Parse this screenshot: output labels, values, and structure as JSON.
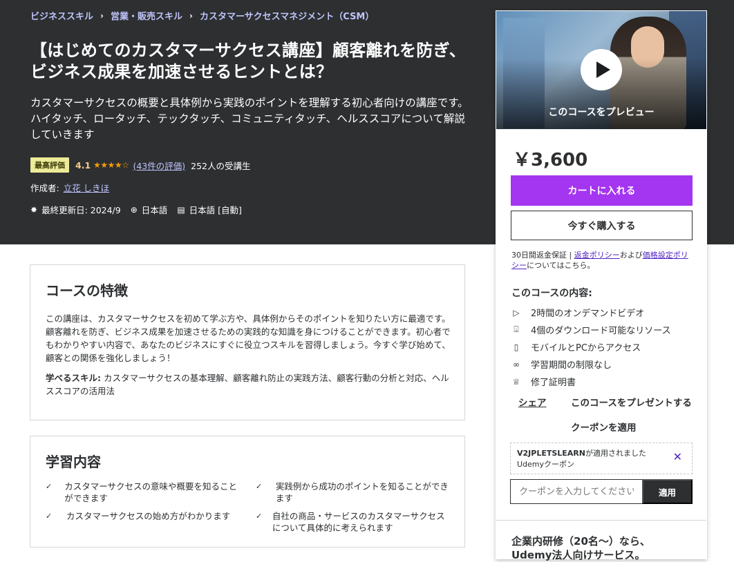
{
  "breadcrumb": [
    "ビジネススキル",
    "営業・販売スキル",
    "カスタマーサクセスマネジメント（CSM）"
  ],
  "breadcrumb_sep": "›",
  "course": {
    "title": "【はじめてのカスタマーサクセス講座】顧客離れを防ぎ、ビジネス成果を加速させるヒントとは？",
    "subtitle": "カスタマーサクセスの概要と具体例から実践のポイントを理解する初心者向けの講座です。ハイタッチ、ロータッチ、テックタッチ、コミュニティタッチ、ヘルススコアについて解説していきます",
    "badge": "最高評価",
    "rating": "4.1",
    "stars": 4.1,
    "stars_glyph": "★★★★☆",
    "reviews": "(43件の評価)",
    "students": "252人の受講生",
    "author_label": "作成者:",
    "author": "立花 しきほ",
    "updated": "最終更新日: 2024/9",
    "language": "日本語",
    "captions": "日本語 [自動]"
  },
  "sidebar": {
    "preview_label": "このコースをプレビュー",
    "price": "￥3,600",
    "cart_button": "カートに入れる",
    "buy_button": "今すぐ購入する",
    "guarantee_prefix": "30日間返金保証 | ",
    "refund_policy": "返金ポリシー",
    "and": "および",
    "pricing_policy": "価格設定ポリシー",
    "guarantee_suffix": "についてはこちら。",
    "includes_title": "このコースの内容:",
    "includes": [
      {
        "icon": "video-icon",
        "label": "2時間のオンデマンドビデオ"
      },
      {
        "icon": "download-icon",
        "label": "4個のダウンロード可能なリソース"
      },
      {
        "icon": "mobile-icon",
        "label": "モバイルとPCからアクセス"
      },
      {
        "icon": "infinity-icon",
        "label": "学習期間の制限なし"
      },
      {
        "icon": "trophy-icon",
        "label": "修了証明書"
      }
    ],
    "share": "シェア",
    "gift": "このコースをプレゼントする",
    "apply_coupon": "クーポンを適用",
    "coupon_code": "V2JPLETSLEARN",
    "coupon_applied": "が適用されました",
    "coupon_type": "Udemyクーポン",
    "coupon_placeholder": "クーポンを入力してください",
    "coupon_apply_button": "適用",
    "business": "企業内研修（20名～）なら、Udemy法人向けサービス。"
  },
  "features": {
    "heading": "コースの特徴",
    "description": "この講座は、カスタマーサクセスを初めて学ぶ方や、具体例からそのポイントを知りたい方に最適です。顧客離れを防ぎ、ビジネス成果を加速させるための実践的な知識を身につけることができます。初心者でもわかりやすい内容で、あなたのビジネスにすぐに役立つスキルを習得しましょう。今すぐ学び始めて、顧客との関係を強化しましょう！",
    "skills_label": "学べるスキル:",
    "skills": " カスタマーサクセスの基本理解、顧客離れ防止の実践方法、顧客行動の分析と対応、ヘルススコアの活用法"
  },
  "learn": {
    "heading": "学習内容",
    "items": [
      "カスタマーサクセスの意味や概要を知ることができます",
      "実践例から成功のポイントを知ることができます",
      "カスタマーサクセスの始め方がわかります",
      "自社の商品・サービスのカスタマーサクセスについて具体的に考えられます"
    ]
  }
}
